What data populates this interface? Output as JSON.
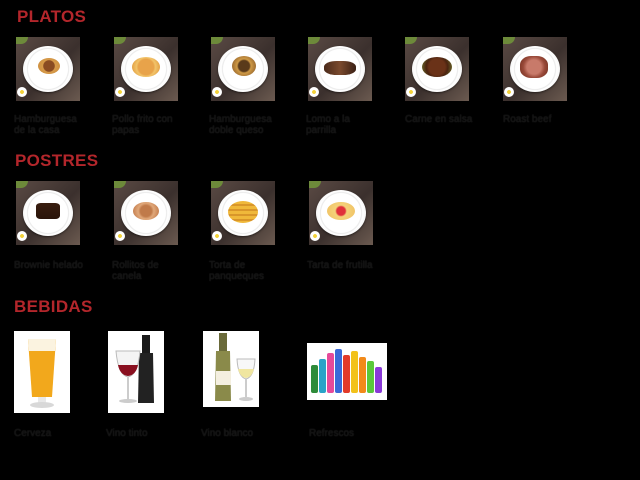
{
  "sections": {
    "platos": {
      "title": "PLATOS"
    },
    "postres": {
      "title": "POSTRES"
    },
    "bebidas": {
      "title": "BEBIDAS"
    }
  },
  "platos": [
    {
      "caption": "Hamburguesa de la casa",
      "icon": "burger-plate-icon"
    },
    {
      "caption": "Pollo frito con papas",
      "icon": "fried-chicken-plate-icon"
    },
    {
      "caption": "Hamburguesa doble queso",
      "icon": "double-burger-plate-icon"
    },
    {
      "caption": "Lomo a la parrilla",
      "icon": "grilled-steak-plate-icon"
    },
    {
      "caption": "Carne en salsa",
      "icon": "meat-sauce-plate-icon"
    },
    {
      "caption": "Roast beef",
      "icon": "roast-beef-plate-icon"
    }
  ],
  "postres": [
    {
      "caption": "Brownie helado",
      "icon": "brownie-plate-icon"
    },
    {
      "caption": "Rollitos de canela",
      "icon": "cinnamon-rolls-plate-icon"
    },
    {
      "caption": "Torta de panqueques",
      "icon": "pancakes-plate-icon"
    },
    {
      "caption": "Tarta de frutilla",
      "icon": "strawberry-tart-plate-icon"
    }
  ],
  "bebidas": [
    {
      "caption": "Cerveza",
      "icon": "beer-glass-icon"
    },
    {
      "caption": "Vino tinto",
      "icon": "red-wine-icon"
    },
    {
      "caption": "Vino blanco",
      "icon": "white-wine-icon"
    },
    {
      "caption": "Refrescos",
      "icon": "soft-drinks-icon"
    }
  ],
  "colors": {
    "background": "#000000",
    "section_title": "#b3262b"
  }
}
